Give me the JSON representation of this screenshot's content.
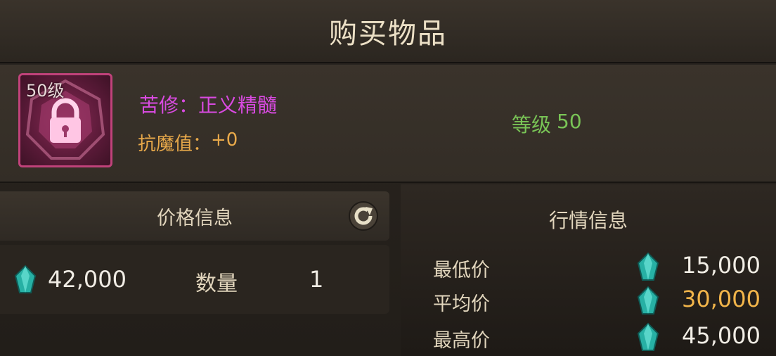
{
  "title": "购买物品",
  "item": {
    "level_tag": "50级",
    "name_prefix": "苦修：",
    "name": "正义精髓",
    "attr_label": "抗魔值：",
    "attr_value": "+0",
    "level_label": "等级",
    "level_value": "50"
  },
  "price_info": {
    "header": "价格信息",
    "price": "42,000",
    "quantity_label": "数量",
    "quantity": "1"
  },
  "market_info": {
    "header": "行情信息",
    "rows": [
      {
        "label": "最低价",
        "value": "15,000",
        "color": "#f0ece4"
      },
      {
        "label": "平均价",
        "value": "30,000",
        "color": "#f2b54a"
      },
      {
        "label": "最高价",
        "value": "45,000",
        "color": "#f0ece4"
      }
    ]
  },
  "colors": {
    "item_name": "#d84ae0",
    "attr": "#e8a94a",
    "level": "#79c456",
    "gem": "#2fc7b8"
  },
  "icons": {
    "item": "lock-icon",
    "refresh": "refresh-icon",
    "currency": "gem-icon"
  }
}
